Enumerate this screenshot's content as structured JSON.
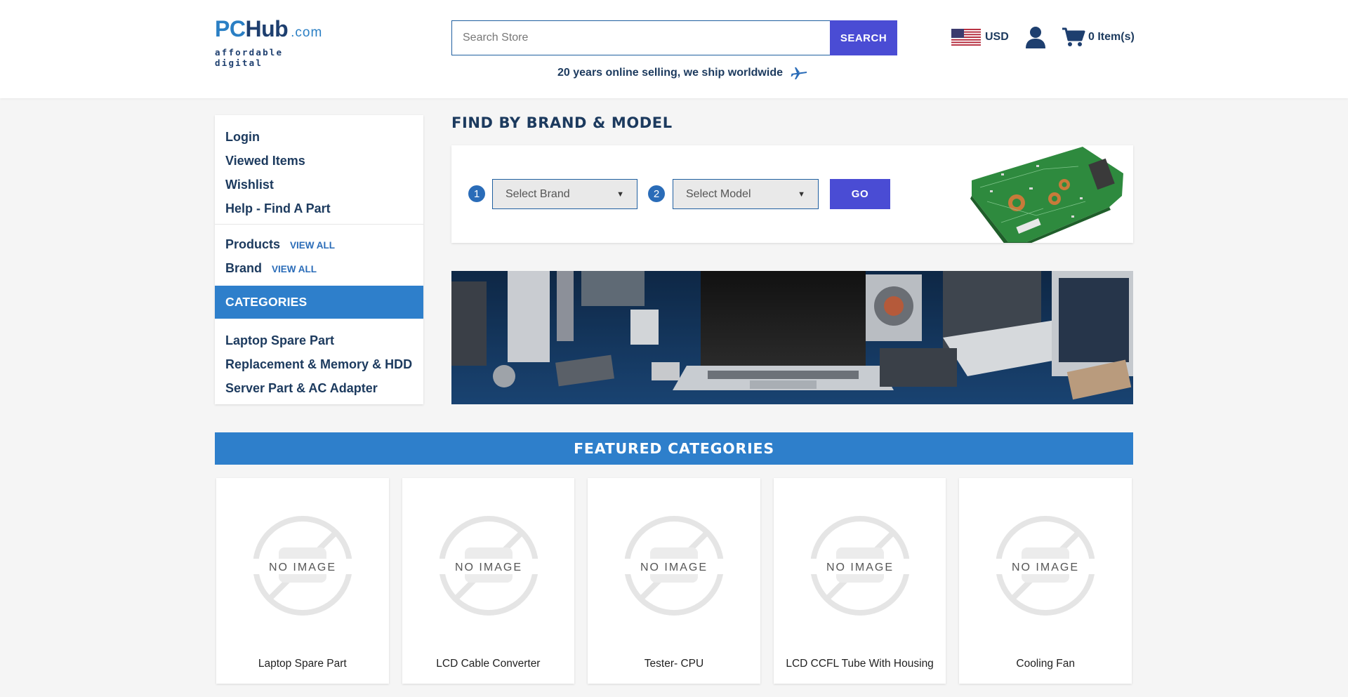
{
  "header": {
    "logo": {
      "brand_pc": "PC",
      "brand_hub": "Hub",
      "brand_com": ".com",
      "tagline": "affordable digital"
    },
    "search": {
      "placeholder": "Search Store",
      "button_label": "SEARCH"
    },
    "shipping_tagline": "20 years online selling, we ship worldwide",
    "currency": "USD",
    "cart_label": "0 Item(s)"
  },
  "sidebar": {
    "account_links": [
      "Login",
      "Viewed Items",
      "Wishlist",
      "Help - Find A Part"
    ],
    "products": {
      "label": "Products",
      "view_all": "VIEW ALL"
    },
    "brand": {
      "label": "Brand",
      "view_all": "VIEW ALL"
    },
    "categories_header": "CATEGORIES",
    "categories": [
      "Laptop Spare Part",
      "Replacement & Memory & HDD",
      "Server Part & AC Adapter"
    ]
  },
  "finder": {
    "title": "FIND BY BRAND & MODEL",
    "step1": "1",
    "step2": "2",
    "brand_select": "Select Brand",
    "model_select": "Select Model",
    "go_label": "GO"
  },
  "featured": {
    "title": "FEATURED CATEGORIES",
    "no_image_text": "NO IMAGE",
    "items": [
      "Laptop Spare Part",
      "LCD Cable Converter",
      "Tester- CPU",
      "LCD CCFL Tube With Housing",
      "Cooling Fan"
    ]
  },
  "colors": {
    "navy": "#1c3a5e",
    "accent_blue": "#2e7fcb",
    "button_purple": "#4a4cd4"
  }
}
